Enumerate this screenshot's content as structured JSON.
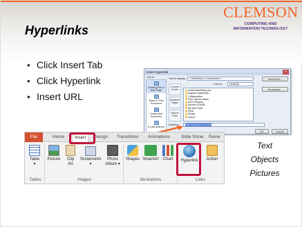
{
  "slide": {
    "title": "Hyperlinks",
    "logo": {
      "word": "CLEMSON",
      "sub1": "COMPUTING AND",
      "sub2": "INFORMATION TECHNOLOGY"
    },
    "bullets": [
      "Click Insert Tab",
      "Click Hyperlink",
      "Insert URL"
    ],
    "side_text": [
      "Text",
      "Objects",
      "Pictures"
    ],
    "colors": {
      "accent": "#f26522",
      "highlight": "#c0123c",
      "file_tab": "#d35230"
    }
  },
  "dialog": {
    "title": "Insert Hyperlink",
    "link_to_label": "Link to:",
    "text_to_display_label": "Text to display:",
    "text_to_display_value": "<<Selection in Document>>",
    "screentip_button": "ScreenTip...",
    "look_in_label": "Look in:",
    "look_in_value": "Desktop",
    "bookmark_button": "Bookmark...",
    "side_items": [
      "Existing File or Web Page",
      "Place in This Document",
      "Create New Document",
      "E-mail Address"
    ],
    "sub_buttons": [
      "Current Folder",
      "Browsed Pages",
      "Recent Files"
    ],
    "files": [
      "AudioSolarMichy.doc",
      "August Leadership",
      "Collaboration",
      "First Citizens Bank",
      "Kid's Pictures",
      "Movies 022808",
      "Ms Huff Stuff",
      "Paris",
      "Songs",
      "dowon"
    ],
    "address_label": "Address:",
    "address_value": "http://www.clemson.edu",
    "ok_button": "OK",
    "cancel_button": "Cancel"
  },
  "ribbon": {
    "tabs": [
      "File",
      "Home",
      "Insert",
      "Design",
      "Transitions",
      "Animations",
      "Slide Show",
      "Revie"
    ],
    "buttons": [
      {
        "label": "Table",
        "sub": "▾"
      },
      {
        "label": "Picture",
        "sub": ""
      },
      {
        "label": "Clip",
        "sub": "Art"
      },
      {
        "label": "Screenshot",
        "sub": "▾"
      },
      {
        "label": "Photo",
        "sub": "Album ▾"
      },
      {
        "label": "Shapes",
        "sub": ""
      },
      {
        "label": "SmartArt",
        "sub": ""
      },
      {
        "label": "Chart",
        "sub": ""
      },
      {
        "label": "Hyperlink",
        "sub": ""
      },
      {
        "label": "Action",
        "sub": ""
      }
    ],
    "groups": [
      "Tables",
      "Images",
      "Illustrations",
      "Links"
    ]
  }
}
